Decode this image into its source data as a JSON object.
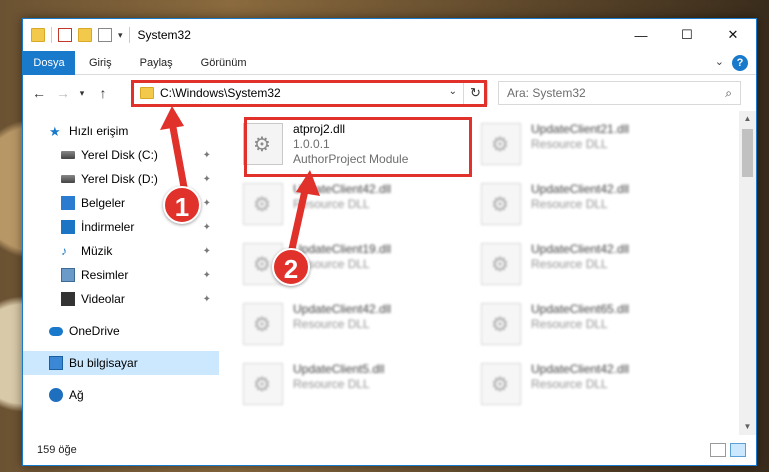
{
  "window": {
    "title": "System32"
  },
  "window_controls": {
    "minimize": "—",
    "maximize": "☐",
    "close": "✕"
  },
  "ribbon": {
    "tabs": [
      "Dosya",
      "Giriş",
      "Paylaş",
      "Görünüm"
    ],
    "help": "?"
  },
  "address": {
    "path": "C:\\Windows\\System32"
  },
  "search": {
    "placeholder": "Ara: System32"
  },
  "nav_pane": {
    "quick_access": "Hızlı erişim",
    "items": [
      {
        "label": "Yerel Disk (C:)",
        "icon": "drive-icon"
      },
      {
        "label": "Yerel Disk (D:)",
        "icon": "drive-icon"
      },
      {
        "label": "Belgeler",
        "icon": "documents-icon"
      },
      {
        "label": "İndirmeler",
        "icon": "downloads-icon"
      },
      {
        "label": "Müzik",
        "icon": "music-icon"
      },
      {
        "label": "Resimler",
        "icon": "pictures-icon"
      },
      {
        "label": "Videolar",
        "icon": "videos-icon"
      }
    ],
    "onedrive": "OneDrive",
    "this_pc": "Bu bilgisayar",
    "network": "Ağ"
  },
  "files": {
    "left": [
      {
        "name": "atproj2.dll",
        "line2": "1.0.0.1",
        "line3": "AuthorProject Module"
      },
      {
        "name": "UpdateClient42.dll",
        "line2": "Resource DLL"
      },
      {
        "name": "UpdateClient19.dll",
        "line2": "Resource DLL"
      },
      {
        "name": "UpdateClient42.dll",
        "line2": "Resource DLL"
      },
      {
        "name": "UpdateClient5.dll",
        "line2": "Resource DLL"
      }
    ],
    "right": [
      {
        "name": "UpdateClient21.dll",
        "line2": "Resource DLL"
      },
      {
        "name": "UpdateClient42.dll",
        "line2": "Resource DLL"
      },
      {
        "name": "UpdateClient42.dll",
        "line2": "Resource DLL"
      },
      {
        "name": "UpdateClient65.dll",
        "line2": "Resource DLL"
      },
      {
        "name": "UpdateClient42.dll",
        "line2": "Resource DLL"
      }
    ]
  },
  "status": {
    "count": "159 öğe"
  },
  "annotations": {
    "badge1": "1",
    "badge2": "2"
  },
  "colors": {
    "accent": "#1979ca",
    "annotation": "#e0312b",
    "selection": "#cce8ff"
  }
}
